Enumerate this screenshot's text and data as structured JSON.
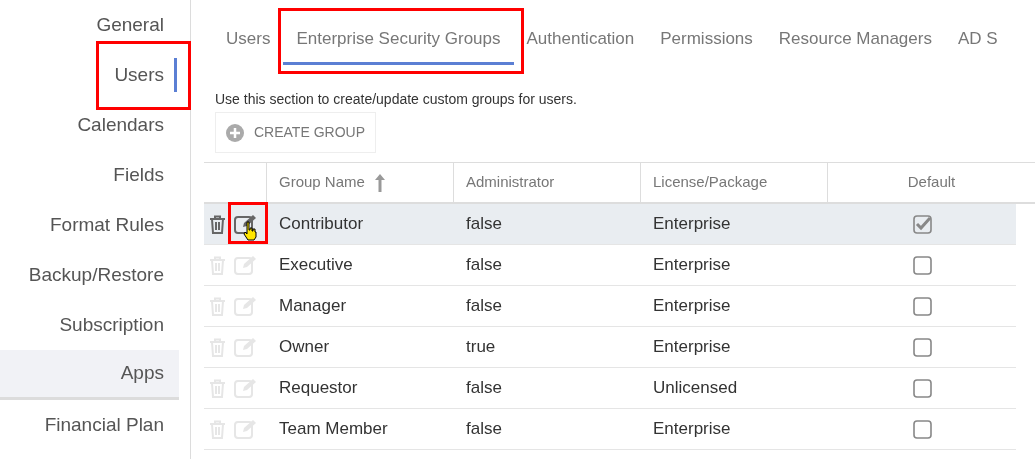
{
  "sidebar": {
    "items": [
      {
        "label": "General",
        "selected": false,
        "hovered": false,
        "annotated": false
      },
      {
        "label": "Users",
        "selected": true,
        "hovered": false,
        "annotated": true
      },
      {
        "label": "Calendars",
        "selected": false,
        "hovered": false,
        "annotated": false
      },
      {
        "label": "Fields",
        "selected": false,
        "hovered": false,
        "annotated": false
      },
      {
        "label": "Format Rules",
        "selected": false,
        "hovered": false,
        "annotated": false
      },
      {
        "label": "Backup/Restore",
        "selected": false,
        "hovered": false,
        "annotated": false
      },
      {
        "label": "Subscription",
        "selected": false,
        "hovered": false,
        "annotated": false
      },
      {
        "label": "Apps",
        "selected": false,
        "hovered": true,
        "annotated": false
      },
      {
        "label": "Financial Plan",
        "selected": false,
        "hovered": false,
        "annotated": false
      }
    ]
  },
  "tabs": [
    {
      "label": "Users",
      "selected": false,
      "annotated": false
    },
    {
      "label": "Enterprise Security Groups",
      "selected": true,
      "annotated": true
    },
    {
      "label": "Authentication",
      "selected": false,
      "annotated": false
    },
    {
      "label": "Permissions",
      "selected": false,
      "annotated": false
    },
    {
      "label": "Resource Managers",
      "selected": false,
      "annotated": false
    },
    {
      "label": "AD S",
      "selected": false,
      "annotated": false
    }
  ],
  "description": "Use this section to create/update custom groups for users.",
  "create_button": {
    "label": "CREATE GROUP"
  },
  "table": {
    "columns": [
      {
        "label": "Group Name",
        "sorted_ascending": true
      },
      {
        "label": "Administrator"
      },
      {
        "label": "License/Package"
      },
      {
        "label": "Default"
      }
    ],
    "rows": [
      {
        "name": "Contributor",
        "administrator": "false",
        "license": "Enterprise",
        "default": true,
        "hovered": true
      },
      {
        "name": "Executive",
        "administrator": "false",
        "license": "Enterprise",
        "default": false,
        "hovered": false
      },
      {
        "name": "Manager",
        "administrator": "false",
        "license": "Enterprise",
        "default": false,
        "hovered": false
      },
      {
        "name": "Owner",
        "administrator": "true",
        "license": "Enterprise",
        "default": false,
        "hovered": false
      },
      {
        "name": "Requestor",
        "administrator": "false",
        "license": "Unlicensed",
        "default": false,
        "hovered": false
      },
      {
        "name": "Team Member",
        "administrator": "false",
        "license": "Enterprise",
        "default": false,
        "hovered": false
      }
    ]
  }
}
